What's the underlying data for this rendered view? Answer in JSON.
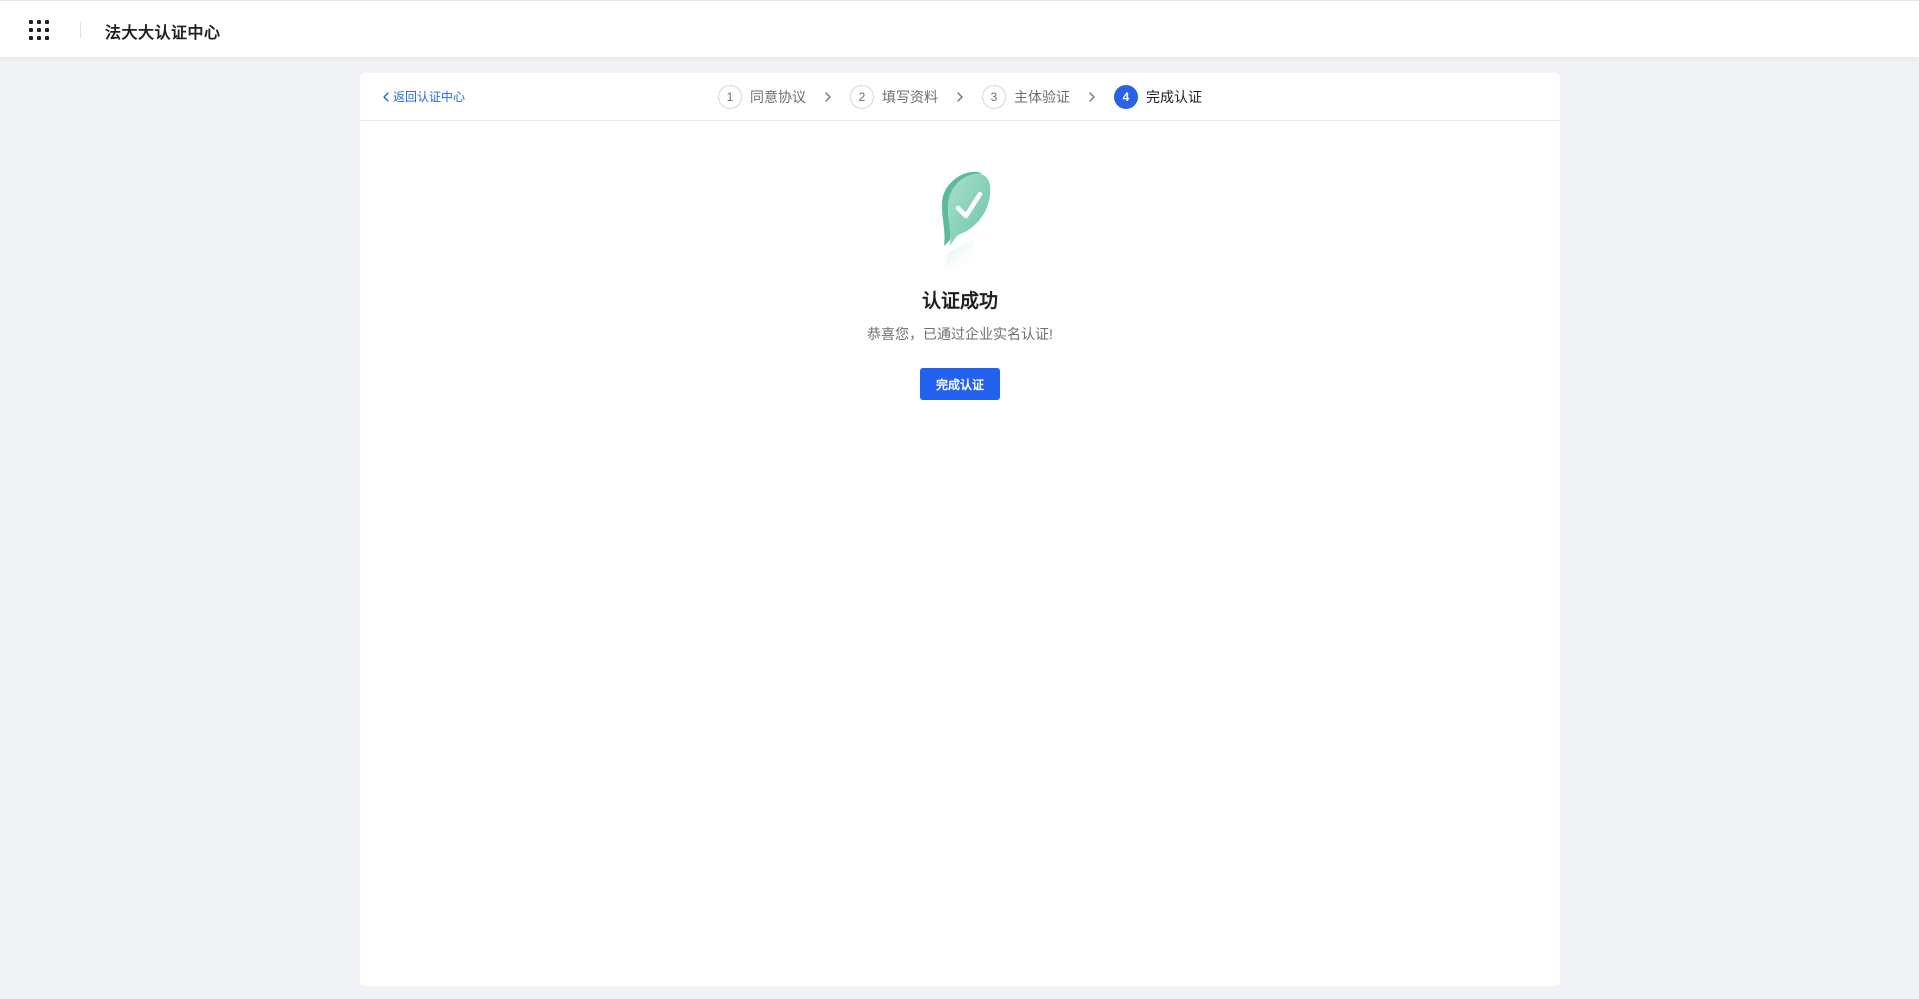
{
  "header": {
    "app_title": "法大大认证中心",
    "apps_icon": "grid-apps-icon"
  },
  "card": {
    "back_label": "返回认证中心",
    "steps": [
      {
        "num": "1",
        "label": "同意协议",
        "state": "done"
      },
      {
        "num": "2",
        "label": "填写资料",
        "state": "done"
      },
      {
        "num": "3",
        "label": "主体验证",
        "state": "done"
      },
      {
        "num": "4",
        "label": "完成认证",
        "state": "active"
      }
    ],
    "result": {
      "icon": "success-check-bubble-icon",
      "title": "认证成功",
      "subtitle": "恭喜您，已通过企业实名认证!",
      "button_label": "完成认证"
    }
  },
  "colors": {
    "accent": "#2262ee",
    "success_green": "#8fd3bd",
    "background": "#f2f3f6"
  }
}
